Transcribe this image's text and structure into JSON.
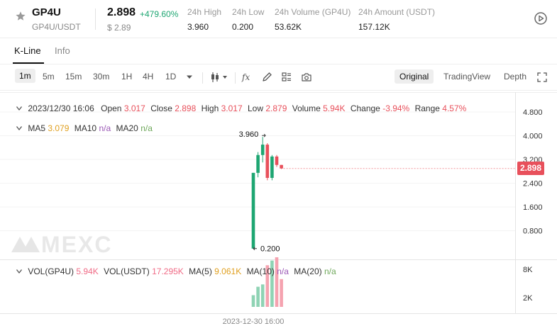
{
  "header": {
    "symbol": "GP4U",
    "pair": "GP4U/USDT",
    "price": "2.898",
    "change_pct": "+479.60%",
    "price_usd": "$ 2.89",
    "stats": [
      {
        "label": "24h High",
        "value": "3.960"
      },
      {
        "label": "24h Low",
        "value": "0.200"
      },
      {
        "label": "24h Volume (GP4U)",
        "value": "53.62K"
      },
      {
        "label": "24h Amount (USDT)",
        "value": "157.12K"
      }
    ]
  },
  "tabs": [
    {
      "label": "K-Line",
      "active": true
    },
    {
      "label": "Info",
      "active": false
    }
  ],
  "toolbar": {
    "intervals": [
      "1m",
      "5m",
      "15m",
      "30m",
      "1H",
      "4H",
      "1D"
    ],
    "selected_interval": "1m",
    "view_modes": [
      "Original",
      "TradingView",
      "Depth"
    ],
    "selected_view_mode": "Original"
  },
  "ohlc_legend": {
    "time": "2023/12/30 16:06",
    "open_label": "Open",
    "open": "3.017",
    "close_label": "Close",
    "close": "2.898",
    "high_label": "High",
    "high": "3.017",
    "low_label": "Low",
    "low": "2.879",
    "volume_label": "Volume",
    "volume": "5.94K",
    "change_label": "Change",
    "change": "-3.94%",
    "range_label": "Range",
    "range": "4.57%"
  },
  "ma_legend": {
    "ma5_label": "MA5",
    "ma5": "3.079",
    "ma10_label": "MA10",
    "ma10": "n/a",
    "ma20_label": "MA20",
    "ma20": "n/a"
  },
  "vol_legend": {
    "vol_gp4u_label": "VOL(GP4U)",
    "vol_gp4u": "5.94K",
    "vol_usdt_label": "VOL(USDT)",
    "vol_usdt": "17.295K",
    "ma5_label": "MA(5)",
    "ma5": "9.061K",
    "ma10_label": "MA(10)",
    "ma10": "n/a",
    "ma20_label": "MA(20)",
    "ma20": "n/a"
  },
  "watermark": "MEXC",
  "current_price_tag": "2.898",
  "colors": {
    "up": "#1ea672",
    "down": "#e8505b",
    "accent": "#111111"
  },
  "chart_data": {
    "type": "candlestick",
    "price_axis_ticks": [
      "4.800",
      "4.000",
      "3.200",
      "2.400",
      "1.600",
      "0.800"
    ],
    "price_axis_values": [
      4.8,
      4.0,
      3.2,
      2.4,
      1.6,
      0.8
    ],
    "volume_axis_ticks": [
      "8K",
      "2K"
    ],
    "volume_axis_values": [
      8000,
      2000
    ],
    "time_label": "2023-12-30 16:00",
    "high_marker": "3.960",
    "low_marker": "0.200",
    "candles": [
      {
        "open": 0.2,
        "high": 2.75,
        "low": 0.2,
        "close": 2.75,
        "volume": 2500
      },
      {
        "open": 2.75,
        "high": 3.45,
        "low": 2.6,
        "close": 3.35,
        "volume": 4300
      },
      {
        "open": 3.35,
        "high": 3.96,
        "low": 3.1,
        "close": 3.7,
        "volume": 4800
      },
      {
        "open": 3.7,
        "high": 3.75,
        "low": 2.5,
        "close": 2.58,
        "volume": 8900
      },
      {
        "open": 2.58,
        "high": 3.35,
        "low": 2.5,
        "close": 3.3,
        "volume": 9900
      },
      {
        "open": 3.3,
        "high": 3.35,
        "low": 2.95,
        "close": 3.017,
        "volume": 10600
      },
      {
        "open": 3.017,
        "high": 3.017,
        "low": 2.879,
        "close": 2.898,
        "volume": 5940
      }
    ]
  }
}
